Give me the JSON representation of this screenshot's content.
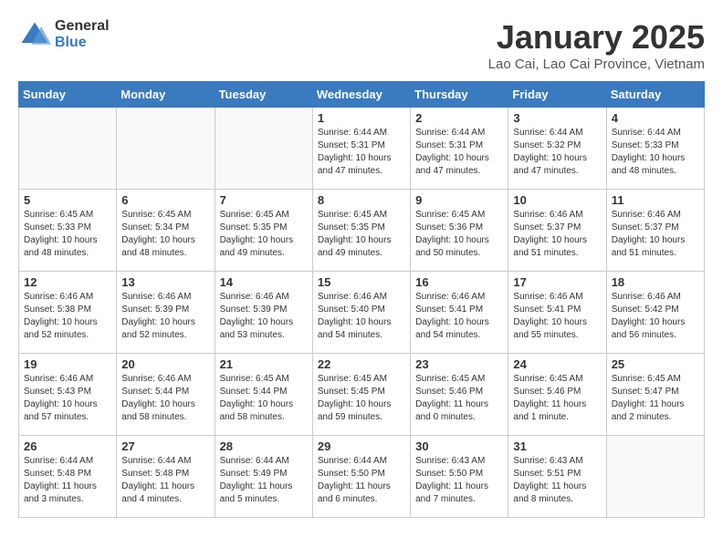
{
  "logo": {
    "general": "General",
    "blue": "Blue"
  },
  "title": "January 2025",
  "subtitle": "Lao Cai, Lao Cai Province, Vietnam",
  "days_of_week": [
    "Sunday",
    "Monday",
    "Tuesday",
    "Wednesday",
    "Thursday",
    "Friday",
    "Saturday"
  ],
  "weeks": [
    [
      {
        "day": "",
        "info": ""
      },
      {
        "day": "",
        "info": ""
      },
      {
        "day": "",
        "info": ""
      },
      {
        "day": "1",
        "info": "Sunrise: 6:44 AM\nSunset: 5:31 PM\nDaylight: 10 hours and 47 minutes."
      },
      {
        "day": "2",
        "info": "Sunrise: 6:44 AM\nSunset: 5:31 PM\nDaylight: 10 hours and 47 minutes."
      },
      {
        "day": "3",
        "info": "Sunrise: 6:44 AM\nSunset: 5:32 PM\nDaylight: 10 hours and 47 minutes."
      },
      {
        "day": "4",
        "info": "Sunrise: 6:44 AM\nSunset: 5:33 PM\nDaylight: 10 hours and 48 minutes."
      }
    ],
    [
      {
        "day": "5",
        "info": "Sunrise: 6:45 AM\nSunset: 5:33 PM\nDaylight: 10 hours and 48 minutes."
      },
      {
        "day": "6",
        "info": "Sunrise: 6:45 AM\nSunset: 5:34 PM\nDaylight: 10 hours and 48 minutes."
      },
      {
        "day": "7",
        "info": "Sunrise: 6:45 AM\nSunset: 5:35 PM\nDaylight: 10 hours and 49 minutes."
      },
      {
        "day": "8",
        "info": "Sunrise: 6:45 AM\nSunset: 5:35 PM\nDaylight: 10 hours and 49 minutes."
      },
      {
        "day": "9",
        "info": "Sunrise: 6:45 AM\nSunset: 5:36 PM\nDaylight: 10 hours and 50 minutes."
      },
      {
        "day": "10",
        "info": "Sunrise: 6:46 AM\nSunset: 5:37 PM\nDaylight: 10 hours and 51 minutes."
      },
      {
        "day": "11",
        "info": "Sunrise: 6:46 AM\nSunset: 5:37 PM\nDaylight: 10 hours and 51 minutes."
      }
    ],
    [
      {
        "day": "12",
        "info": "Sunrise: 6:46 AM\nSunset: 5:38 PM\nDaylight: 10 hours and 52 minutes."
      },
      {
        "day": "13",
        "info": "Sunrise: 6:46 AM\nSunset: 5:39 PM\nDaylight: 10 hours and 52 minutes."
      },
      {
        "day": "14",
        "info": "Sunrise: 6:46 AM\nSunset: 5:39 PM\nDaylight: 10 hours and 53 minutes."
      },
      {
        "day": "15",
        "info": "Sunrise: 6:46 AM\nSunset: 5:40 PM\nDaylight: 10 hours and 54 minutes."
      },
      {
        "day": "16",
        "info": "Sunrise: 6:46 AM\nSunset: 5:41 PM\nDaylight: 10 hours and 54 minutes."
      },
      {
        "day": "17",
        "info": "Sunrise: 6:46 AM\nSunset: 5:41 PM\nDaylight: 10 hours and 55 minutes."
      },
      {
        "day": "18",
        "info": "Sunrise: 6:46 AM\nSunset: 5:42 PM\nDaylight: 10 hours and 56 minutes."
      }
    ],
    [
      {
        "day": "19",
        "info": "Sunrise: 6:46 AM\nSunset: 5:43 PM\nDaylight: 10 hours and 57 minutes."
      },
      {
        "day": "20",
        "info": "Sunrise: 6:46 AM\nSunset: 5:44 PM\nDaylight: 10 hours and 58 minutes."
      },
      {
        "day": "21",
        "info": "Sunrise: 6:45 AM\nSunset: 5:44 PM\nDaylight: 10 hours and 58 minutes."
      },
      {
        "day": "22",
        "info": "Sunrise: 6:45 AM\nSunset: 5:45 PM\nDaylight: 10 hours and 59 minutes."
      },
      {
        "day": "23",
        "info": "Sunrise: 6:45 AM\nSunset: 5:46 PM\nDaylight: 11 hours and 0 minutes."
      },
      {
        "day": "24",
        "info": "Sunrise: 6:45 AM\nSunset: 5:46 PM\nDaylight: 11 hours and 1 minute."
      },
      {
        "day": "25",
        "info": "Sunrise: 6:45 AM\nSunset: 5:47 PM\nDaylight: 11 hours and 2 minutes."
      }
    ],
    [
      {
        "day": "26",
        "info": "Sunrise: 6:44 AM\nSunset: 5:48 PM\nDaylight: 11 hours and 3 minutes."
      },
      {
        "day": "27",
        "info": "Sunrise: 6:44 AM\nSunset: 5:48 PM\nDaylight: 11 hours and 4 minutes."
      },
      {
        "day": "28",
        "info": "Sunrise: 6:44 AM\nSunset: 5:49 PM\nDaylight: 11 hours and 5 minutes."
      },
      {
        "day": "29",
        "info": "Sunrise: 6:44 AM\nSunset: 5:50 PM\nDaylight: 11 hours and 6 minutes."
      },
      {
        "day": "30",
        "info": "Sunrise: 6:43 AM\nSunset: 5:50 PM\nDaylight: 11 hours and 7 minutes."
      },
      {
        "day": "31",
        "info": "Sunrise: 6:43 AM\nSunset: 5:51 PM\nDaylight: 11 hours and 8 minutes."
      },
      {
        "day": "",
        "info": ""
      }
    ]
  ]
}
